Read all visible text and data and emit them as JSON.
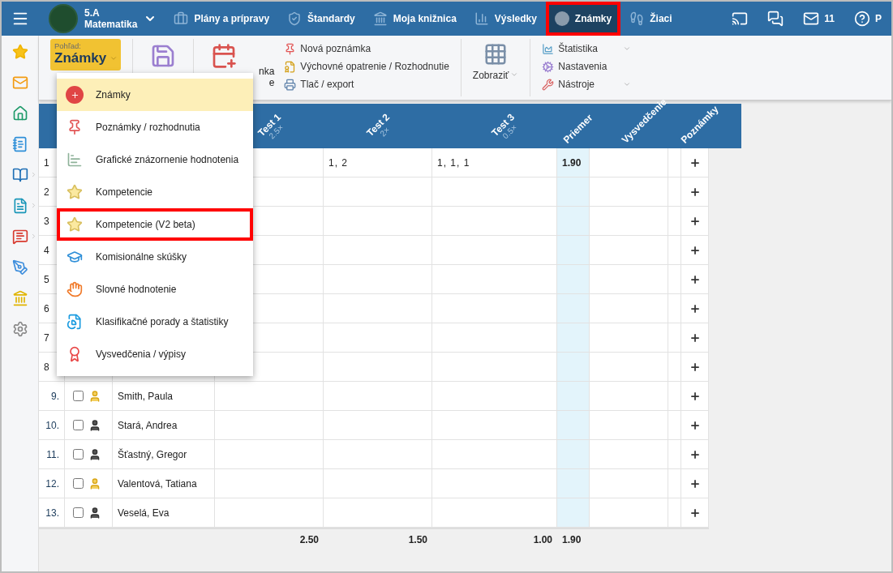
{
  "topbar": {
    "class_name": "5.A",
    "subject": "Matematika",
    "nav": [
      {
        "label": "Plány a prípravy",
        "kind": "plans",
        "selected": false,
        "highlighted": false
      },
      {
        "label": "Štandardy",
        "kind": "standards",
        "selected": false,
        "highlighted": false
      },
      {
        "label": "Moja knižnica",
        "kind": "library",
        "selected": false,
        "highlighted": false
      },
      {
        "label": "Výsledky",
        "kind": "results",
        "selected": false,
        "highlighted": false
      },
      {
        "label": "Známky",
        "kind": "grades",
        "selected": true,
        "highlighted": true
      },
      {
        "label": "Žiaci",
        "kind": "students",
        "selected": false,
        "highlighted": false
      }
    ],
    "messages_count": "11",
    "cut_label": "P"
  },
  "sidebar": {
    "items": [
      {
        "kind": "favorites",
        "expandable": false
      },
      {
        "kind": "mail",
        "expandable": false
      },
      {
        "kind": "home",
        "expandable": false
      },
      {
        "kind": "notebook",
        "expandable": false
      },
      {
        "kind": "book",
        "expandable": true
      },
      {
        "kind": "document",
        "expandable": true
      },
      {
        "kind": "chat",
        "expandable": true
      },
      {
        "kind": "pen",
        "expandable": false
      },
      {
        "kind": "institution",
        "expandable": false
      },
      {
        "kind": "settings",
        "expandable": false
      }
    ]
  },
  "toolbar": {
    "view_caption": "Pohľad:",
    "view_value": "Známky",
    "covered_label": [
      "nka",
      "e"
    ],
    "actions": [
      {
        "label": "Nová poznámka",
        "kind": "pin"
      },
      {
        "label": "Výchovné opatrenie / Rozhodnutie",
        "kind": "measure"
      },
      {
        "label": "Tlač / export",
        "kind": "print"
      }
    ],
    "display": "Zobraziť",
    "tools": [
      {
        "label": "Štatistika",
        "kind": "stats",
        "has_menu": true
      },
      {
        "label": "Nastavenia",
        "kind": "settings",
        "has_menu": false
      },
      {
        "label": "Nástroje",
        "kind": "tools",
        "has_menu": true
      }
    ]
  },
  "view_menu": [
    {
      "label": "Známky",
      "kind": "grade",
      "selected": true,
      "highlighted": false
    },
    {
      "label": "Poznámky / rozhodnutia",
      "kind": "pin",
      "selected": false,
      "highlighted": false
    },
    {
      "label": "Grafické znázornenie hodnotenia",
      "kind": "chart",
      "selected": false,
      "highlighted": false
    },
    {
      "label": "Kompetencie",
      "kind": "star",
      "selected": false,
      "highlighted": false
    },
    {
      "label": "Kompetencie (V2 beta)",
      "kind": "star",
      "selected": false,
      "highlighted": true
    },
    {
      "label": "Komisionálne skúšky",
      "kind": "exam",
      "selected": false,
      "highlighted": false
    },
    {
      "label": "Slovné hodnotenie",
      "kind": "verbal",
      "selected": false,
      "highlighted": false
    },
    {
      "label": "Klasifikačné porady a štatistiky",
      "kind": "report",
      "selected": false,
      "highlighted": false
    },
    {
      "label": "Vysvedčenia / výpisy",
      "kind": "certificate",
      "selected": false,
      "highlighted": false
    }
  ],
  "table": {
    "columns": [
      {
        "label": "Test 1",
        "weight": "2.5×",
        "kind": "test"
      },
      {
        "label": "Test 2",
        "weight": "2×",
        "kind": "test"
      },
      {
        "label": "Test 3",
        "weight": "0.5×",
        "kind": "test"
      },
      {
        "label": "Priemer",
        "kind": "average"
      },
      {
        "label": "Vysvedčenie",
        "kind": "certificate"
      },
      {
        "label": "Poznámky",
        "kind": "notes"
      }
    ],
    "rows": [
      {
        "number": "1",
        "test_2": "1, 2",
        "test_3": "1, 1, 1",
        "average": "1.90"
      },
      {
        "number": "2"
      },
      {
        "number": "3"
      },
      {
        "number": "4"
      },
      {
        "number": "5"
      },
      {
        "number": "6"
      },
      {
        "number": "7"
      },
      {
        "number": "8"
      },
      {
        "number": "9.",
        "name": "Smith, Paula",
        "kind": "blond",
        "checked": false
      },
      {
        "number": "10.",
        "name": "Stará, Andrea",
        "kind": "dark",
        "checked": false
      },
      {
        "number": "11.",
        "name": "Šťastný, Gregor",
        "kind": "dark",
        "checked": false
      },
      {
        "number": "12.",
        "name": "Valentová, Tatiana",
        "kind": "blond",
        "checked": false
      },
      {
        "number": "13.",
        "name": "Veselá, Eva",
        "kind": "dark",
        "checked": false
      }
    ],
    "totals": [
      "2.50",
      "1.50",
      "1.00",
      "1.90"
    ]
  }
}
